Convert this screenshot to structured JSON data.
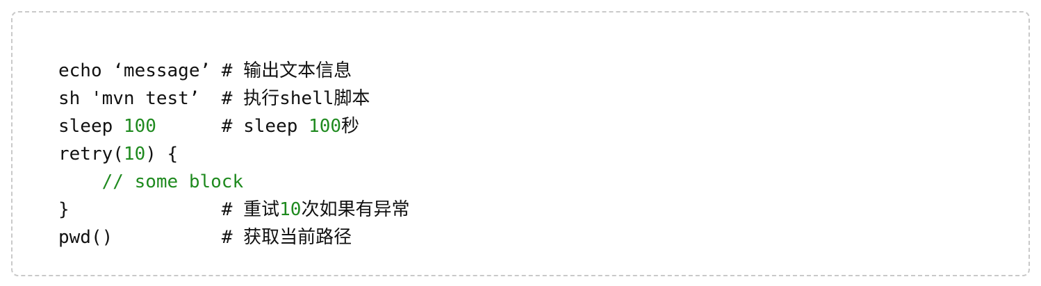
{
  "code": {
    "lines": [
      [
        "echo ‘message’ # 输出文本信息"
      ],
      [
        "sh 'mvn test’  # 执行shell脚本"
      ],
      [
        "sleep ",
        "100",
        "      # sleep ",
        "100",
        "秒"
      ],
      [
        "retry(",
        "10",
        ") {"
      ],
      [
        "    ",
        "// some block"
      ],
      [
        "}",
        "              # 重试",
        "10",
        "次如果有异常"
      ],
      [
        "pwd()",
        "          # 获取当前路径"
      ]
    ]
  },
  "colors": {
    "text": "#111111",
    "number": "#1f8a1f",
    "comment": "#1f8a1f",
    "border": "#c9c9c9"
  }
}
